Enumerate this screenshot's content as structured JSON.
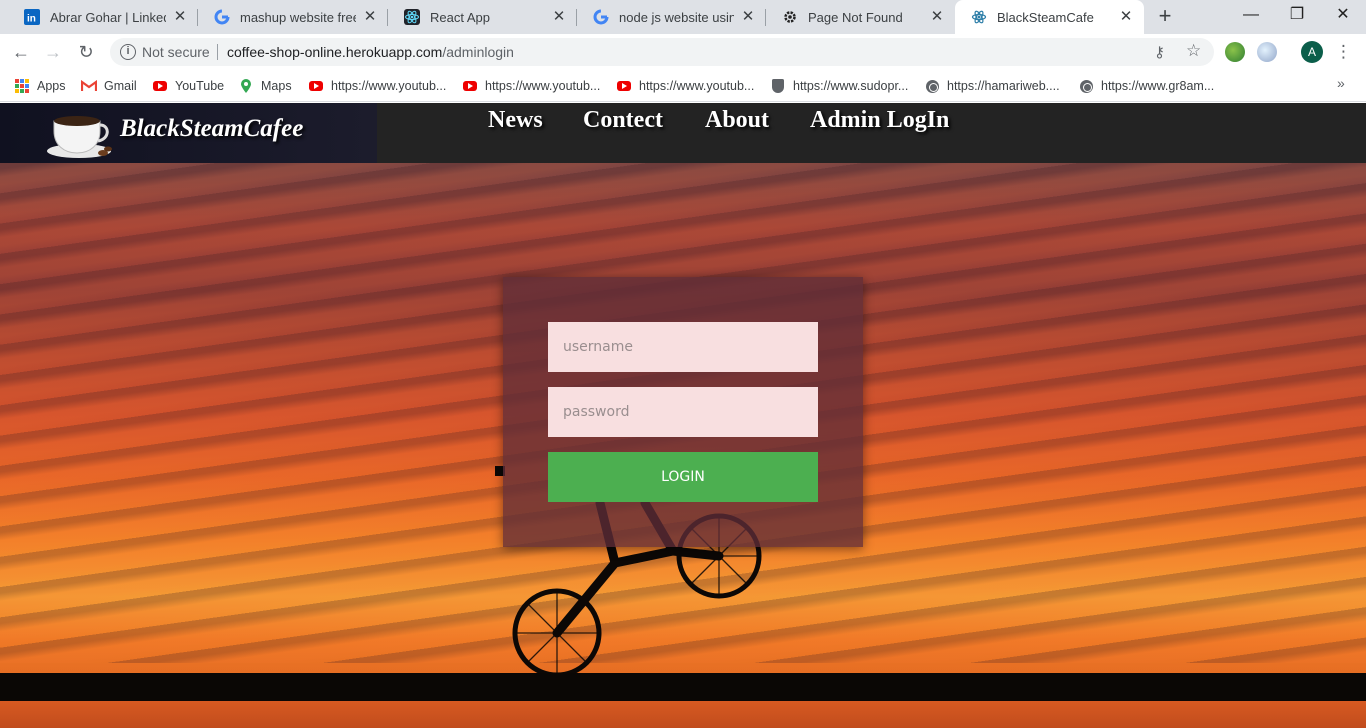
{
  "browser": {
    "tabs": [
      {
        "title": "Abrar Gohar | LinkedIn",
        "favicon": "linkedin-icon",
        "close": "✕"
      },
      {
        "title": "mashup website free - G",
        "favicon": "google-icon",
        "close": "✕"
      },
      {
        "title": "React App",
        "favicon": "react-icon",
        "close": "✕"
      },
      {
        "title": "node js website using h",
        "favicon": "google-icon",
        "close": "✕"
      },
      {
        "title": "Page Not Found",
        "favicon": "gear-icon",
        "close": "✕"
      },
      {
        "title": "BlackSteamCafe",
        "favicon": "react-icon",
        "close": "✕",
        "active": true
      }
    ],
    "new_tab": "+",
    "window_controls": {
      "minimize": "—",
      "maximize": "❐",
      "close": "✕"
    },
    "toolbar": {
      "back": "←",
      "forward": "→",
      "reload": "↻"
    },
    "address": {
      "security_label": "Not secure",
      "host": "coffee-shop-online.herokuapp.com",
      "path": "/adminlogin"
    },
    "profile_initial": "A",
    "bookmarks": [
      {
        "label": "Apps",
        "icon": "apps-grid-icon"
      },
      {
        "label": "Gmail",
        "icon": "gmail-icon"
      },
      {
        "label": "YouTube",
        "icon": "youtube-icon"
      },
      {
        "label": "Maps",
        "icon": "maps-icon"
      },
      {
        "label": "https://www.youtub...",
        "icon": "youtube-icon"
      },
      {
        "label": "https://www.youtub...",
        "icon": "youtube-icon"
      },
      {
        "label": "https://www.youtub...",
        "icon": "youtube-icon"
      },
      {
        "label": "https://www.sudopr...",
        "icon": "shield-icon"
      },
      {
        "label": "https://hamariweb....",
        "icon": "globe-icon"
      },
      {
        "label": "https://www.gr8am...",
        "icon": "globe-icon"
      }
    ],
    "bookmarks_more": "»"
  },
  "site": {
    "brand": "BlackSteamCafee",
    "nav": [
      "News",
      "Contect",
      "About",
      "Admin LogIn"
    ],
    "login": {
      "username_placeholder": "username",
      "password_placeholder": "password",
      "submit_label": "LOGIN",
      "button_color": "#4caf50"
    }
  }
}
